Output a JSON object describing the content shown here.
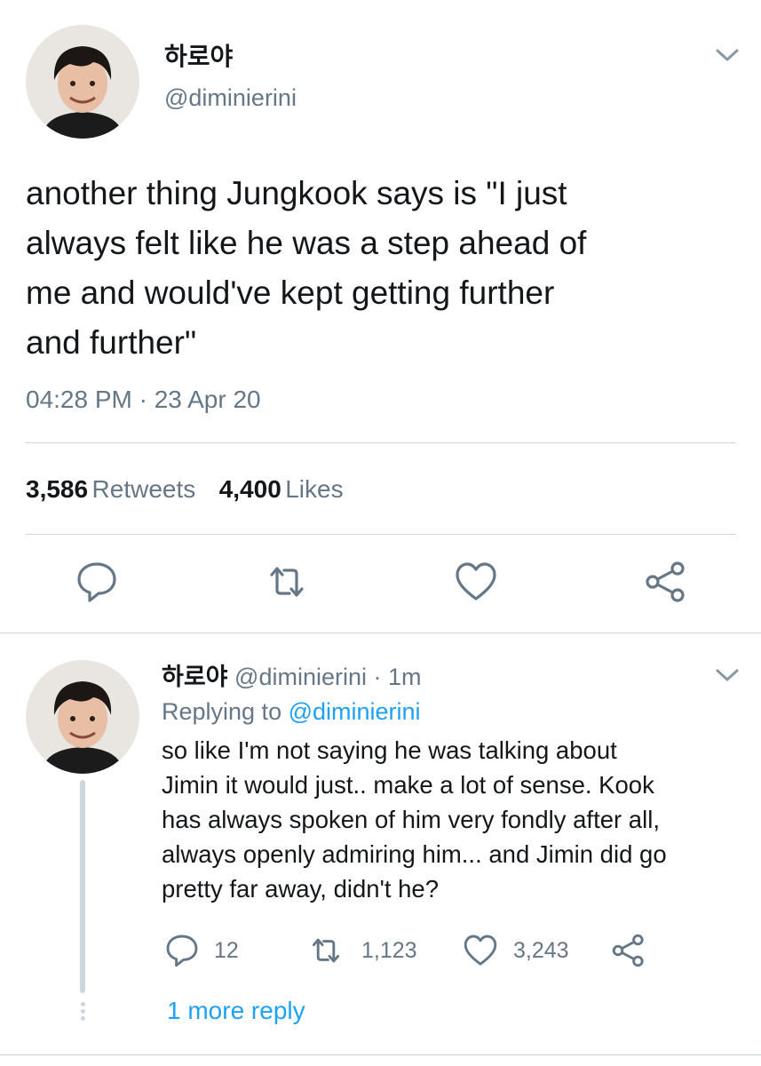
{
  "tweet": {
    "display_name": "하로야",
    "handle": "@diminierini",
    "text_lines": [
      "another thing Jungkook says is \"I just",
      "always felt like he was a step ahead of",
      "me and would've kept getting further",
      "and further\""
    ],
    "timestamp": "04:28 PM · 23 Apr 20",
    "retweets_count": "3,586",
    "retweets_label": "Retweets",
    "likes_count": "4,400",
    "likes_label": "Likes"
  },
  "reply": {
    "display_name": "하로야",
    "handle": "@diminierini · 1m",
    "replying_to_prefix": "Replying to ",
    "replying_to_handle": "@diminierini",
    "text_lines": [
      "so like I'm not saying he was talking about",
      "Jimin it would just.. make a lot of sense. Kook",
      "has always spoken of him very fondly after all,",
      "always openly admiring him... and Jimin did go",
      "pretty far away, didn't he?"
    ],
    "reply_count": "12",
    "retweet_count": "1,123",
    "like_count": "3,243",
    "more_replies": "1 more reply"
  },
  "icons": {
    "reply": "reply-icon",
    "retweet": "retweet-icon",
    "like": "heart-icon",
    "share": "share-icon",
    "menu": "chevron-down-icon"
  },
  "colors": {
    "link": "#1da1f2",
    "muted": "#657786",
    "divider": "#ccd6dd",
    "text": "#14171a"
  }
}
